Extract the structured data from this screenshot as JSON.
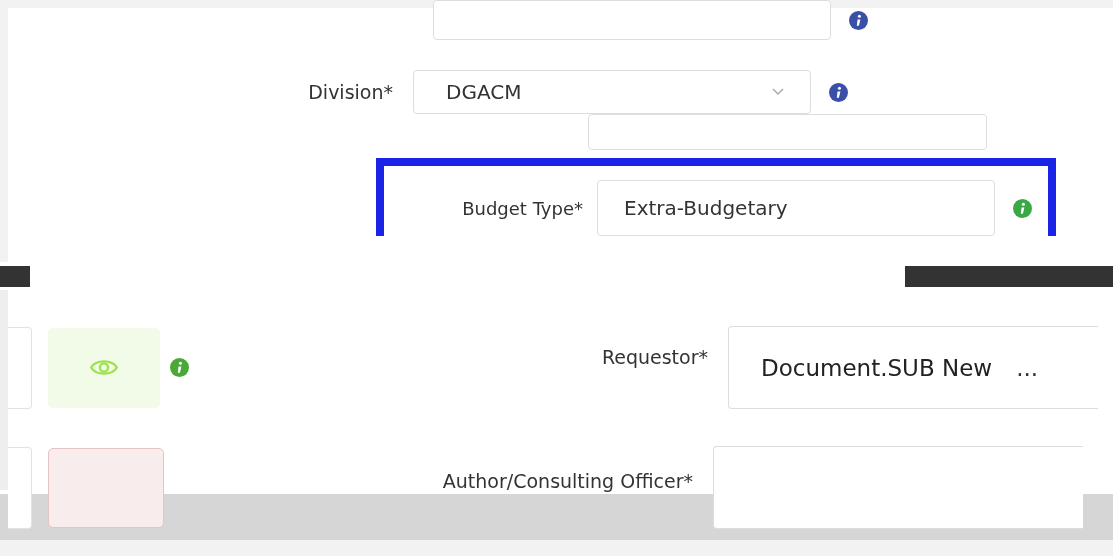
{
  "upper_form": {
    "division": {
      "label": "Division*",
      "value": "DGACM"
    },
    "budget_type": {
      "label": "Budget Type*",
      "value": "Extra-Budgetary",
      "highlighted": true
    }
  },
  "lower_form": {
    "requestor": {
      "label": "Requestor*",
      "value": "Document.SUB New",
      "more": "..."
    },
    "author": {
      "label": "Author/Consulting Officer*"
    }
  }
}
